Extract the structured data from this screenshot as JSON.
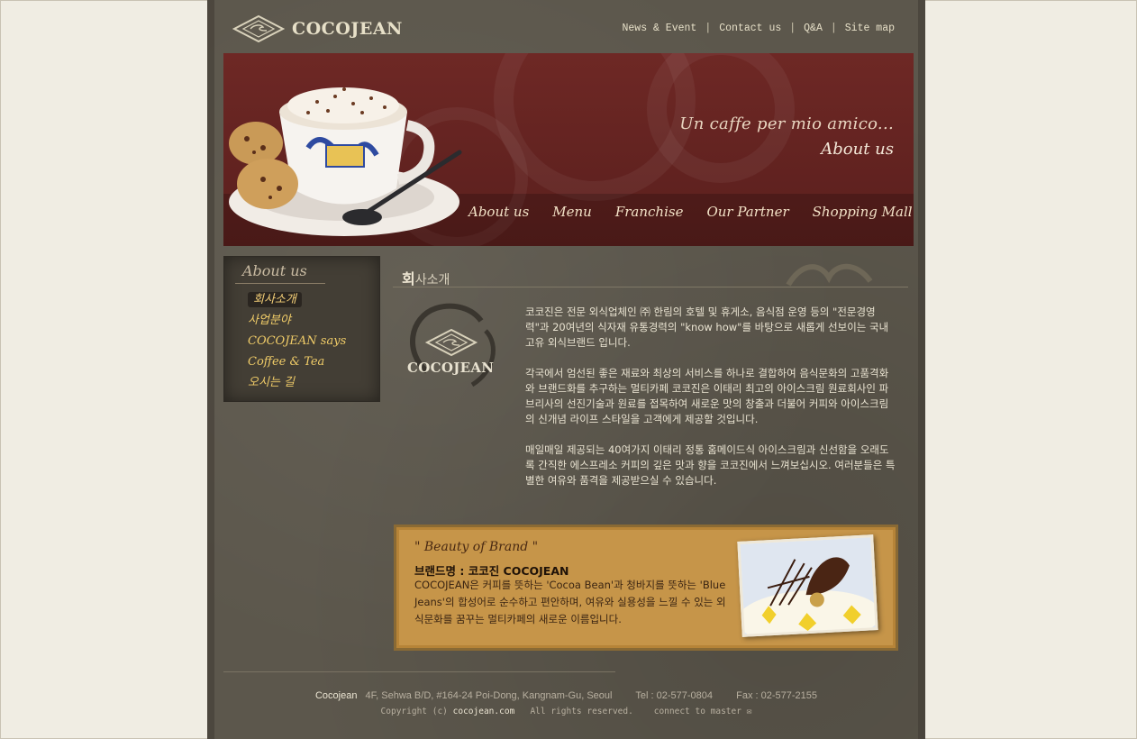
{
  "header": {
    "logo_text": "COCOJEAN",
    "top_links": [
      "News & Event",
      "Contact us",
      "Q&A",
      "Site map"
    ]
  },
  "banner": {
    "slogan": "Un caffe per mio amico...",
    "subtitle": "About us",
    "nav": [
      "About us",
      "Menu",
      "Franchise",
      "Our Partner",
      "Shopping Mall"
    ],
    "colors": {
      "banner": "#6e2825",
      "accent": "#f0cc68"
    }
  },
  "sidebar": {
    "title": "About us",
    "items": [
      "회사소개",
      "사업분야",
      "COCOJEAN says",
      "Coffee & Tea",
      "오시는 길"
    ]
  },
  "content": {
    "title_bold": "회",
    "title_rest": "사소개",
    "emblem_text": "COCOJEAN",
    "paragraphs": [
      "코코진은 전문 외식업체인 ㈜ 한림의 호텔 및 휴게소, 음식점 운영 등의 \"전문경영력\"과 20여년의 식자재 유통경력의 \"know how\"를 바탕으로 새롭게 선보이는 국내고유 외식브랜드 입니다.",
      "각국에서 엄선된 좋은 재료와 최상의 서비스를 하나로 결합하여 음식문화의 고품격화와 브랜드화를 추구하는 멀티카페 코코진은 이태리 최고의 아이스크림 원료회사인 파브리사의 선진기술과 원료를 접목하여 새로운 맛의 창출과 더불어 커피와 아이스크림의 신개념 라이프 스타일을 고객에게 제공할 것입니다.",
      "매일매일 제공되는 40여가지 이태리 정통 홈메이드식 아이스크림과 신선함을 오래도록 간직한 에스프레소 커피의 깊은 맛과 향을 코코진에서 느껴보십시오. 여러분들은 특별한 여유와 품격을 제공받으실 수 있습니다."
    ]
  },
  "brand_box": {
    "heading": "\" Beauty of Brand \"",
    "name": "브랜드명 : 코코진 COCOJEAN",
    "description": "COCOJEAN은 커피를 뜻하는 'Cocoa Bean'과 청바지를 뜻하는 'Blue Jeans'의 합성어로 순수하고 편안하며, 여유와 실용성을 느낄 수 있는 외식문화를 꿈꾸는 멀티카페의 새로운 이름입니다."
  },
  "footer": {
    "company": "Cocojean",
    "address": "4F, Sehwa B/D, #164-24 Poi-Dong, Kangnam-Gu, Seoul",
    "tel": "Tel : 02-577-0804",
    "fax": "Fax : 02-577-2155",
    "copyright_prefix": "Copyright (c)",
    "domain": "cocojean.com",
    "rights": "All rights reserved.",
    "connect": "connect to master"
  }
}
